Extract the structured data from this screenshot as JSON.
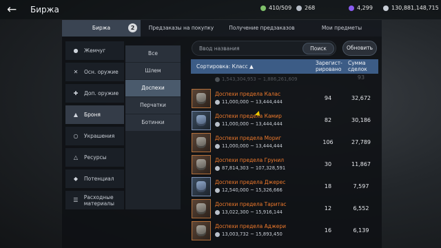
{
  "header": {
    "back_icon": "arrow-left-icon",
    "title": "Биржа",
    "stats": [
      {
        "icon": "energy-icon",
        "color": "#7fc06a",
        "value": "410/509"
      },
      {
        "icon": "weight-icon",
        "color": "#b8bec8",
        "value": "268"
      },
      {
        "icon": "pearl-icon",
        "color": "#8a5cf0",
        "value": "4,299"
      },
      {
        "icon": "silver-icon",
        "color": "#c8ced6",
        "value": "130,881,148,715"
      }
    ]
  },
  "tabs": [
    "Биржа",
    "Предзаказы на покупку",
    "Получение предзаказов",
    "Мои предметы"
  ],
  "tab_badge": "2",
  "categories": [
    {
      "icon": "pearl-icon",
      "label": "Жемчуг"
    },
    {
      "icon": "crossed-swords-icon",
      "label": "Осн. оружие"
    },
    {
      "icon": "dagger-icon",
      "label": "Доп. оружие"
    },
    {
      "icon": "armor-icon",
      "label": "Броня"
    },
    {
      "icon": "ring-icon",
      "label": "Украшения"
    },
    {
      "icon": "flask-icon",
      "label": "Ресурсы"
    },
    {
      "icon": "diamond-icon",
      "label": "Потенциал"
    },
    {
      "icon": "scroll-icon",
      "label": "Расходные материалы"
    }
  ],
  "subcategories": [
    "Все",
    "Шлем",
    "Доспехи",
    "Перчатки",
    "Ботинки"
  ],
  "search": {
    "placeholder": "Ввод названия",
    "button": "Поиск"
  },
  "refresh_button": "Обновить",
  "table": {
    "sort_label": "Сортировка: Класс ▲",
    "col_registered": "Зарегист-рировано",
    "col_sum": "Сумма сделок",
    "partial_row": {
      "price": "1,543,304,953 ~ 1,886,261,609",
      "sum": "93"
    },
    "rows": [
      {
        "name": "Доспехи предела Калас",
        "price": "11,000,000 ~ 13,444,444",
        "registered": "94",
        "sum": "32,672",
        "tint": "brown"
      },
      {
        "name": "Доспехи предела Камир",
        "price": "11,000,000 ~ 13,444,444",
        "registered": "82",
        "sum": "30,186",
        "tint": "blue"
      },
      {
        "name": "Доспехи предела Мориг",
        "price": "11,000,000 ~ 13,444,444",
        "registered": "106",
        "sum": "27,789",
        "tint": "brown"
      },
      {
        "name": "Доспехи предела Грунил",
        "price": "87,814,303 ~ 107,328,591",
        "registered": "30",
        "sum": "11,867",
        "tint": "brown"
      },
      {
        "name": "Доспехи предела Джерес",
        "price": "12,540,000 ~ 15,326,666",
        "registered": "18",
        "sum": "7,597",
        "tint": "blue"
      },
      {
        "name": "Доспехи предела Таритас",
        "price": "13,022,300 ~ 15,916,144",
        "registered": "12",
        "sum": "6,552",
        "tint": "brown"
      },
      {
        "name": "Доспехи предела Аджери",
        "price": "13,003,732 ~ 15,893,450",
        "registered": "16",
        "sum": "6,139",
        "tint": "brown"
      }
    ]
  }
}
